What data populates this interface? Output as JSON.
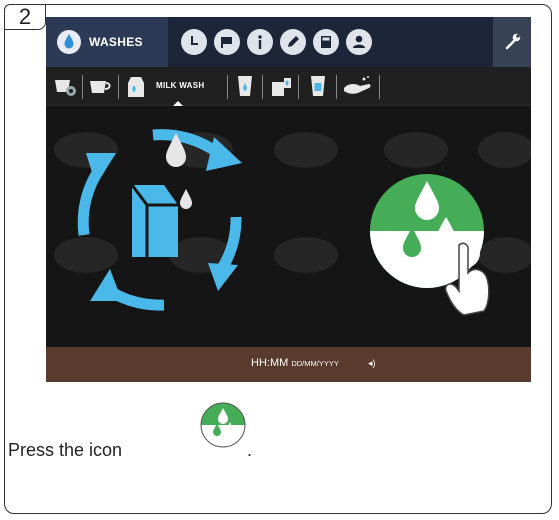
{
  "step_number": "2",
  "screen": {
    "top_tab_label": "WASHES",
    "sub_tab_label": "MILK WASH",
    "footer_time": "HH:MM",
    "footer_date": "DD/MM/YYYY",
    "volume_glyph": "◂)"
  },
  "instruction_text": "Press the icon",
  "instruction_period": ".",
  "colors": {
    "accent_green": "#45ad57",
    "cycle_blue": "#4bb8ea",
    "topbar": "#1d2638",
    "footer": "#5a3a2c"
  },
  "icons": [
    "drop-icon",
    "clock-icon",
    "flag-icon",
    "info-icon",
    "pencil-icon",
    "calculator-icon",
    "user-icon",
    "wrench-icon",
    "cup-gear-icon",
    "cup-icon",
    "milk-carton-icon",
    "glass-drop-icon",
    "milk-jug-icon",
    "glass-icon",
    "hand-wash-icon",
    "wash-cycle-icon",
    "milk-wash-start-button",
    "hand-pointer-icon"
  ]
}
